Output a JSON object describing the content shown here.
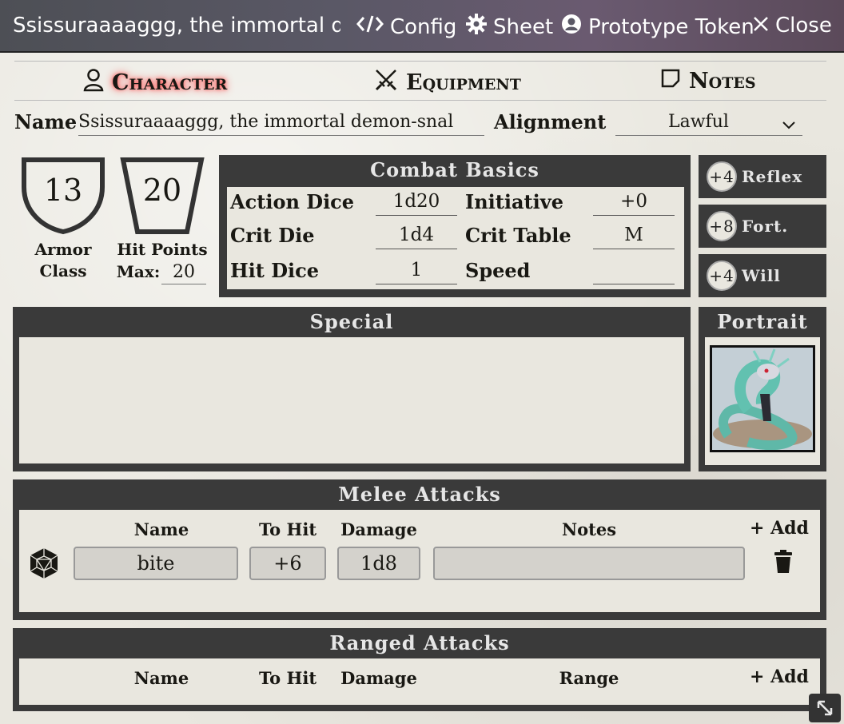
{
  "window": {
    "title": "Ssissuraaaaggg, the immortal de",
    "config": "Config",
    "sheet": "Sheet",
    "prototype_token": "Prototype Token",
    "close": "Close"
  },
  "tabs": [
    {
      "label": "Character",
      "icon": "user-icon",
      "active": true
    },
    {
      "label": "Equipment",
      "icon": "crossed-swords-icon",
      "active": false
    },
    {
      "label": "Notes",
      "icon": "note-icon",
      "active": false
    }
  ],
  "identity": {
    "name_label": "Name",
    "name_value": "Ssissuraaaaggg, the immortal demon-snal",
    "alignment_label": "Alignment",
    "alignment_value": "Lawful"
  },
  "armor_class": {
    "value": "13",
    "label_line1": "Armor",
    "label_line2": "Class"
  },
  "hit_points": {
    "value": "20",
    "label": "Hit Points",
    "max_label": "Max:",
    "max_value": "20"
  },
  "combat_basics": {
    "title": "Combat Basics",
    "action_dice_label": "Action Dice",
    "action_dice": "1d20",
    "initiative_label": "Initiative",
    "initiative": "+0",
    "crit_die_label": "Crit Die",
    "crit_die": "1d4",
    "crit_table_label": "Crit Table",
    "crit_table": "M",
    "hit_dice_label": "Hit Dice",
    "hit_dice": "1",
    "speed_label": "Speed",
    "speed": ""
  },
  "saves": [
    {
      "value": "+4",
      "label": "Reflex"
    },
    {
      "value": "+8",
      "label": "Fort."
    },
    {
      "value": "+4",
      "label": "Will"
    }
  ],
  "special": {
    "title": "Special",
    "text": ""
  },
  "portrait": {
    "title": "Portrait"
  },
  "melee": {
    "title": "Melee Attacks",
    "col_name": "Name",
    "col_to_hit": "To Hit",
    "col_damage": "Damage",
    "col_notes": "Notes",
    "add": "+ Add",
    "rows": [
      {
        "name": "bite",
        "to_hit": "+6",
        "damage": "1d8",
        "notes": ""
      }
    ]
  },
  "ranged": {
    "title": "Ranged Attacks",
    "col_name": "Name",
    "col_to_hit": "To Hit",
    "col_damage": "Damage",
    "col_range": "Range",
    "add": "+ Add"
  },
  "colors": {
    "frame": "#3a3a3a",
    "parchment": "#e9e7df",
    "active_glow": "#ff3b3b"
  }
}
